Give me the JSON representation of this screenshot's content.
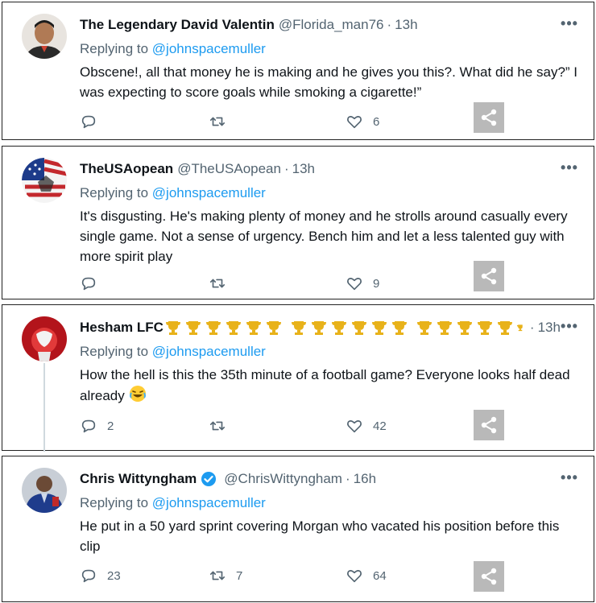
{
  "replies": [
    {
      "name": "The Legendary David Valentin",
      "handle": "@Florida_man76",
      "separator": "·",
      "time": "13h",
      "replying_prefix": "Replying to",
      "replying_to": "@johnspacemuller",
      "text": "Obscene!, all that money he is making and he gives you this?. What did he say?” I was expecting to score goals while smoking a cigarette!”",
      "reply_count": "",
      "retweet_count": "",
      "like_count": "6"
    },
    {
      "name": "TheUSAopean",
      "handle": "@TheUSAopean",
      "separator": "·",
      "time": "13h",
      "replying_prefix": "Replying to",
      "replying_to": "@johnspacemuller",
      "text": "It's disgusting. He's making plenty of money and he strolls around casually every single game. Not a sense of urgency. Bench him and let a less talented guy with more spirit play",
      "reply_count": "",
      "retweet_count": "",
      "like_count": "9"
    },
    {
      "name": "Hesham LFC",
      "handle": "",
      "separator": "·",
      "time": "13h",
      "replying_prefix": "Replying to",
      "replying_to": "@johnspacemuller",
      "text": "How the hell is this the 35th minute of a football game? Everyone looks half dead already",
      "reply_count": "2",
      "retweet_count": "",
      "like_count": "42"
    },
    {
      "name": "Chris Wittyngham",
      "handle": "@ChrisWittyngham",
      "separator": "·",
      "time": "16h",
      "replying_prefix": "Replying to",
      "replying_to": "@johnspacemuller",
      "text": "He put in a 50 yard sprint covering Morgan who vacated his position before this clip",
      "reply_count": "23",
      "retweet_count": "7",
      "like_count": "64"
    }
  ],
  "more_label": "•••",
  "colors": {
    "accent": "#1d9bf0",
    "secondary_text": "#536471",
    "trophy": "#e8b21a",
    "share_bg": "#b9b9b9"
  }
}
